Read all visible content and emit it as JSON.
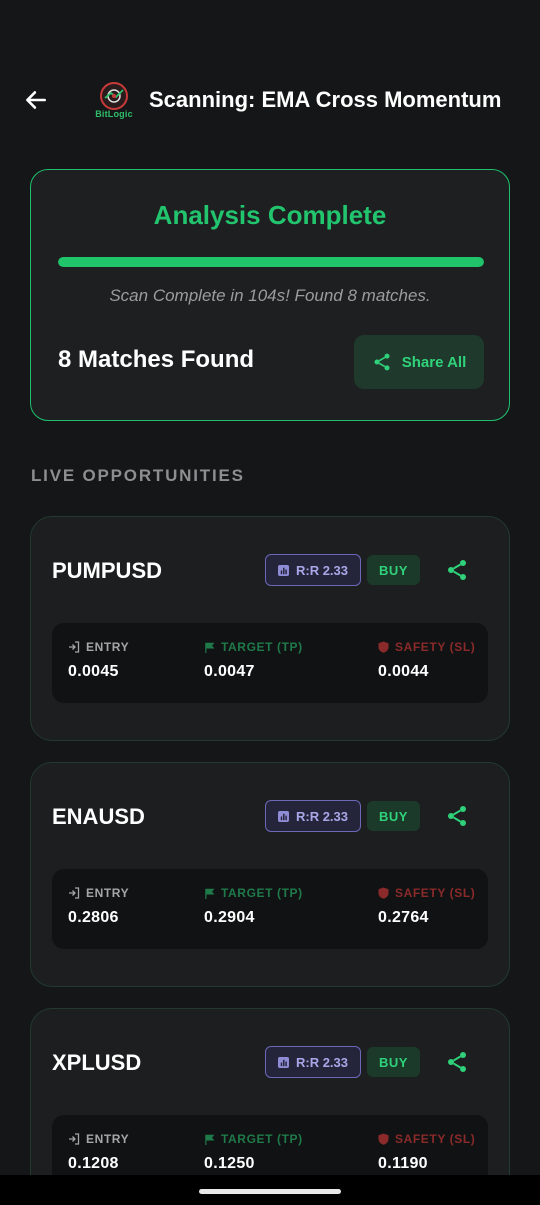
{
  "header": {
    "title": "Scanning: EMA Cross Momentum",
    "logo_text": "BitLogic"
  },
  "status": {
    "title": "Analysis Complete",
    "progress": 1.0,
    "subtitle": "Scan Complete in 104s! Found 8 matches.",
    "matches": "8 Matches Found",
    "share_all_label": "Share All"
  },
  "section_label": "LIVE OPPORTUNITIES",
  "labels": {
    "entry": "ENTRY",
    "target": "TARGET (TP)",
    "safety": "SAFETY (SL)"
  },
  "opportunities": [
    {
      "symbol": "PUMPUSD",
      "rr": "R:R 2.33",
      "signal": "BUY",
      "entry": "0.0045",
      "target": "0.0047",
      "safety": "0.0044"
    },
    {
      "symbol": "ENAUSD",
      "rr": "R:R 2.33",
      "signal": "BUY",
      "entry": "0.2806",
      "target": "0.2904",
      "safety": "0.2764"
    },
    {
      "symbol": "XPLUSD",
      "rr": "R:R 2.33",
      "signal": "BUY",
      "entry": "0.1208",
      "target": "0.1250",
      "safety": "0.1190"
    }
  ],
  "colors": {
    "accent_green": "#22c46e",
    "rr_purple": "#a9a7e8",
    "safety_red": "#8a2a2a",
    "background": "#151617"
  },
  "icons": {
    "back": "arrow-left-icon",
    "share": "share-icon",
    "entry": "login-arrow-icon",
    "target": "flag-icon",
    "safety": "shield-icon",
    "rr": "chart-icon"
  }
}
